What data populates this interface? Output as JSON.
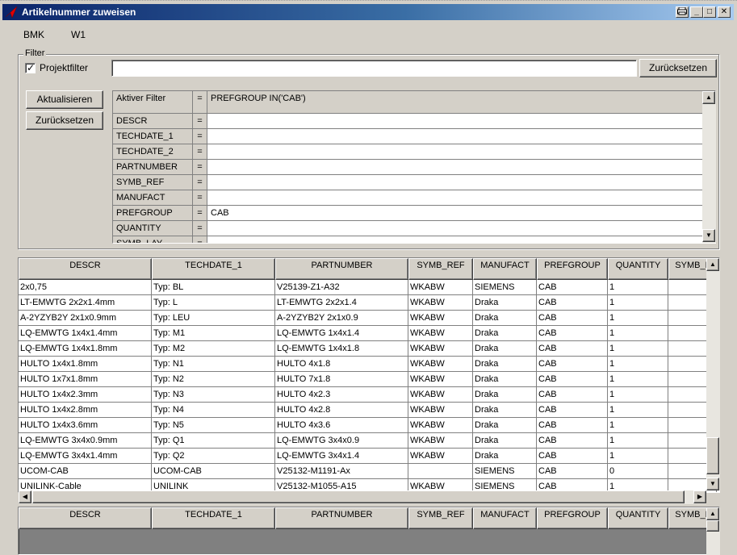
{
  "window": {
    "title": "Artikelnummer zuweisen",
    "app_icon": "red-arrow-icon",
    "controls": [
      "print-icon",
      "minimize-icon",
      "maximize-icon",
      "close-icon"
    ]
  },
  "header": {
    "bmk_label": "BMK",
    "bmk_value": "W1"
  },
  "filter": {
    "group_label": "Filter",
    "checkbox_label": "Projektfilter",
    "checkbox_checked": true,
    "text_value": "",
    "reset_top_label": "Zurücksetzen",
    "refresh_label": "Aktualisieren",
    "reset_left_label": "Zurücksetzen",
    "active_filter_label": "Aktiver Filter",
    "active_filter_eq": "=",
    "active_filter_value": "PREFGROUP IN('CAB')",
    "rows": [
      {
        "field": "DESCR",
        "eq": "=",
        "value": ""
      },
      {
        "field": "TECHDATE_1",
        "eq": "=",
        "value": ""
      },
      {
        "field": "TECHDATE_2",
        "eq": "=",
        "value": ""
      },
      {
        "field": "PARTNUMBER",
        "eq": "=",
        "value": ""
      },
      {
        "field": "SYMB_REF",
        "eq": "=",
        "value": ""
      },
      {
        "field": "MANUFACT",
        "eq": "=",
        "value": ""
      },
      {
        "field": "PREFGROUP",
        "eq": "=",
        "value": "CAB"
      },
      {
        "field": "QUANTITY",
        "eq": "=",
        "value": ""
      },
      {
        "field": "SYMB_LAY",
        "eq": "=",
        "value": ""
      }
    ]
  },
  "results": {
    "columns": [
      "DESCR",
      "TECHDATE_1",
      "PARTNUMBER",
      "SYMB_REF",
      "MANUFACT",
      "PREFGROUP",
      "QUANTITY",
      "SYMB_L"
    ],
    "rows": [
      [
        "2x0,75",
        "Typ: BL",
        "V25139-Z1-A32",
        "WKABW",
        "SIEMENS",
        "CAB",
        "1",
        ""
      ],
      [
        "LT-EMWTG 2x2x1.4mm",
        "Typ: L",
        "LT-EMWTG 2x2x1.4",
        "WKABW",
        "Draka",
        "CAB",
        "1",
        ""
      ],
      [
        "A-2YZYB2Y 2x1x0.9mm",
        "Typ: LEU",
        "A-2YZYB2Y 2x1x0.9",
        "WKABW",
        "Draka",
        "CAB",
        "1",
        ""
      ],
      [
        "LQ-EMWTG 1x4x1.4mm",
        "Typ: M1",
        "LQ-EMWTG 1x4x1.4",
        "WKABW",
        "Draka",
        "CAB",
        "1",
        ""
      ],
      [
        "LQ-EMWTG 1x4x1.8mm",
        "Typ: M2",
        "LQ-EMWTG 1x4x1.8",
        "WKABW",
        "Draka",
        "CAB",
        "1",
        ""
      ],
      [
        "HULTO 1x4x1.8mm",
        "Typ: N1",
        "HULTO 4x1.8",
        "WKABW",
        "Draka",
        "CAB",
        "1",
        ""
      ],
      [
        "HULTO 1x7x1.8mm",
        "Typ: N2",
        "HULTO 7x1.8",
        "WKABW",
        "Draka",
        "CAB",
        "1",
        ""
      ],
      [
        "HULTO 1x4x2.3mm",
        "Typ: N3",
        "HULTO 4x2.3",
        "WKABW",
        "Draka",
        "CAB",
        "1",
        ""
      ],
      [
        "HULTO 1x4x2.8mm",
        "Typ: N4",
        "HULTO 4x2.8",
        "WKABW",
        "Draka",
        "CAB",
        "1",
        ""
      ],
      [
        "HULTO 1x4x3.6mm",
        "Typ: N5",
        "HULTO 4x3.6",
        "WKABW",
        "Draka",
        "CAB",
        "1",
        ""
      ],
      [
        "LQ-EMWTG 3x4x0.9mm",
        "Typ: Q1",
        "LQ-EMWTG 3x4x0.9",
        "WKABW",
        "Draka",
        "CAB",
        "1",
        ""
      ],
      [
        "LQ-EMWTG 3x4x1.4mm",
        "Typ: Q2",
        "LQ-EMWTG 3x4x1.4",
        "WKABW",
        "Draka",
        "CAB",
        "1",
        ""
      ],
      [
        "UCOM-CAB",
        "UCOM-CAB",
        "V25132-M1191-Ax",
        "",
        "SIEMENS",
        "CAB",
        "0",
        ""
      ],
      [
        "UNILINK-Cable",
        "UNILINK",
        "V25132-M1055-A15",
        "WKABW",
        "SIEMENS",
        "CAB",
        "1",
        ""
      ]
    ]
  },
  "selection": {
    "columns": [
      "DESCR",
      "TECHDATE_1",
      "PARTNUMBER",
      "SYMB_REF",
      "MANUFACT",
      "PREFGROUP",
      "QUANTITY",
      "SYMB_L"
    ],
    "rows": []
  },
  "colors": {
    "title_start": "#0a246a",
    "title_end": "#a6caf0",
    "face": "#d4d0c8",
    "empty_grid": "#808080"
  }
}
